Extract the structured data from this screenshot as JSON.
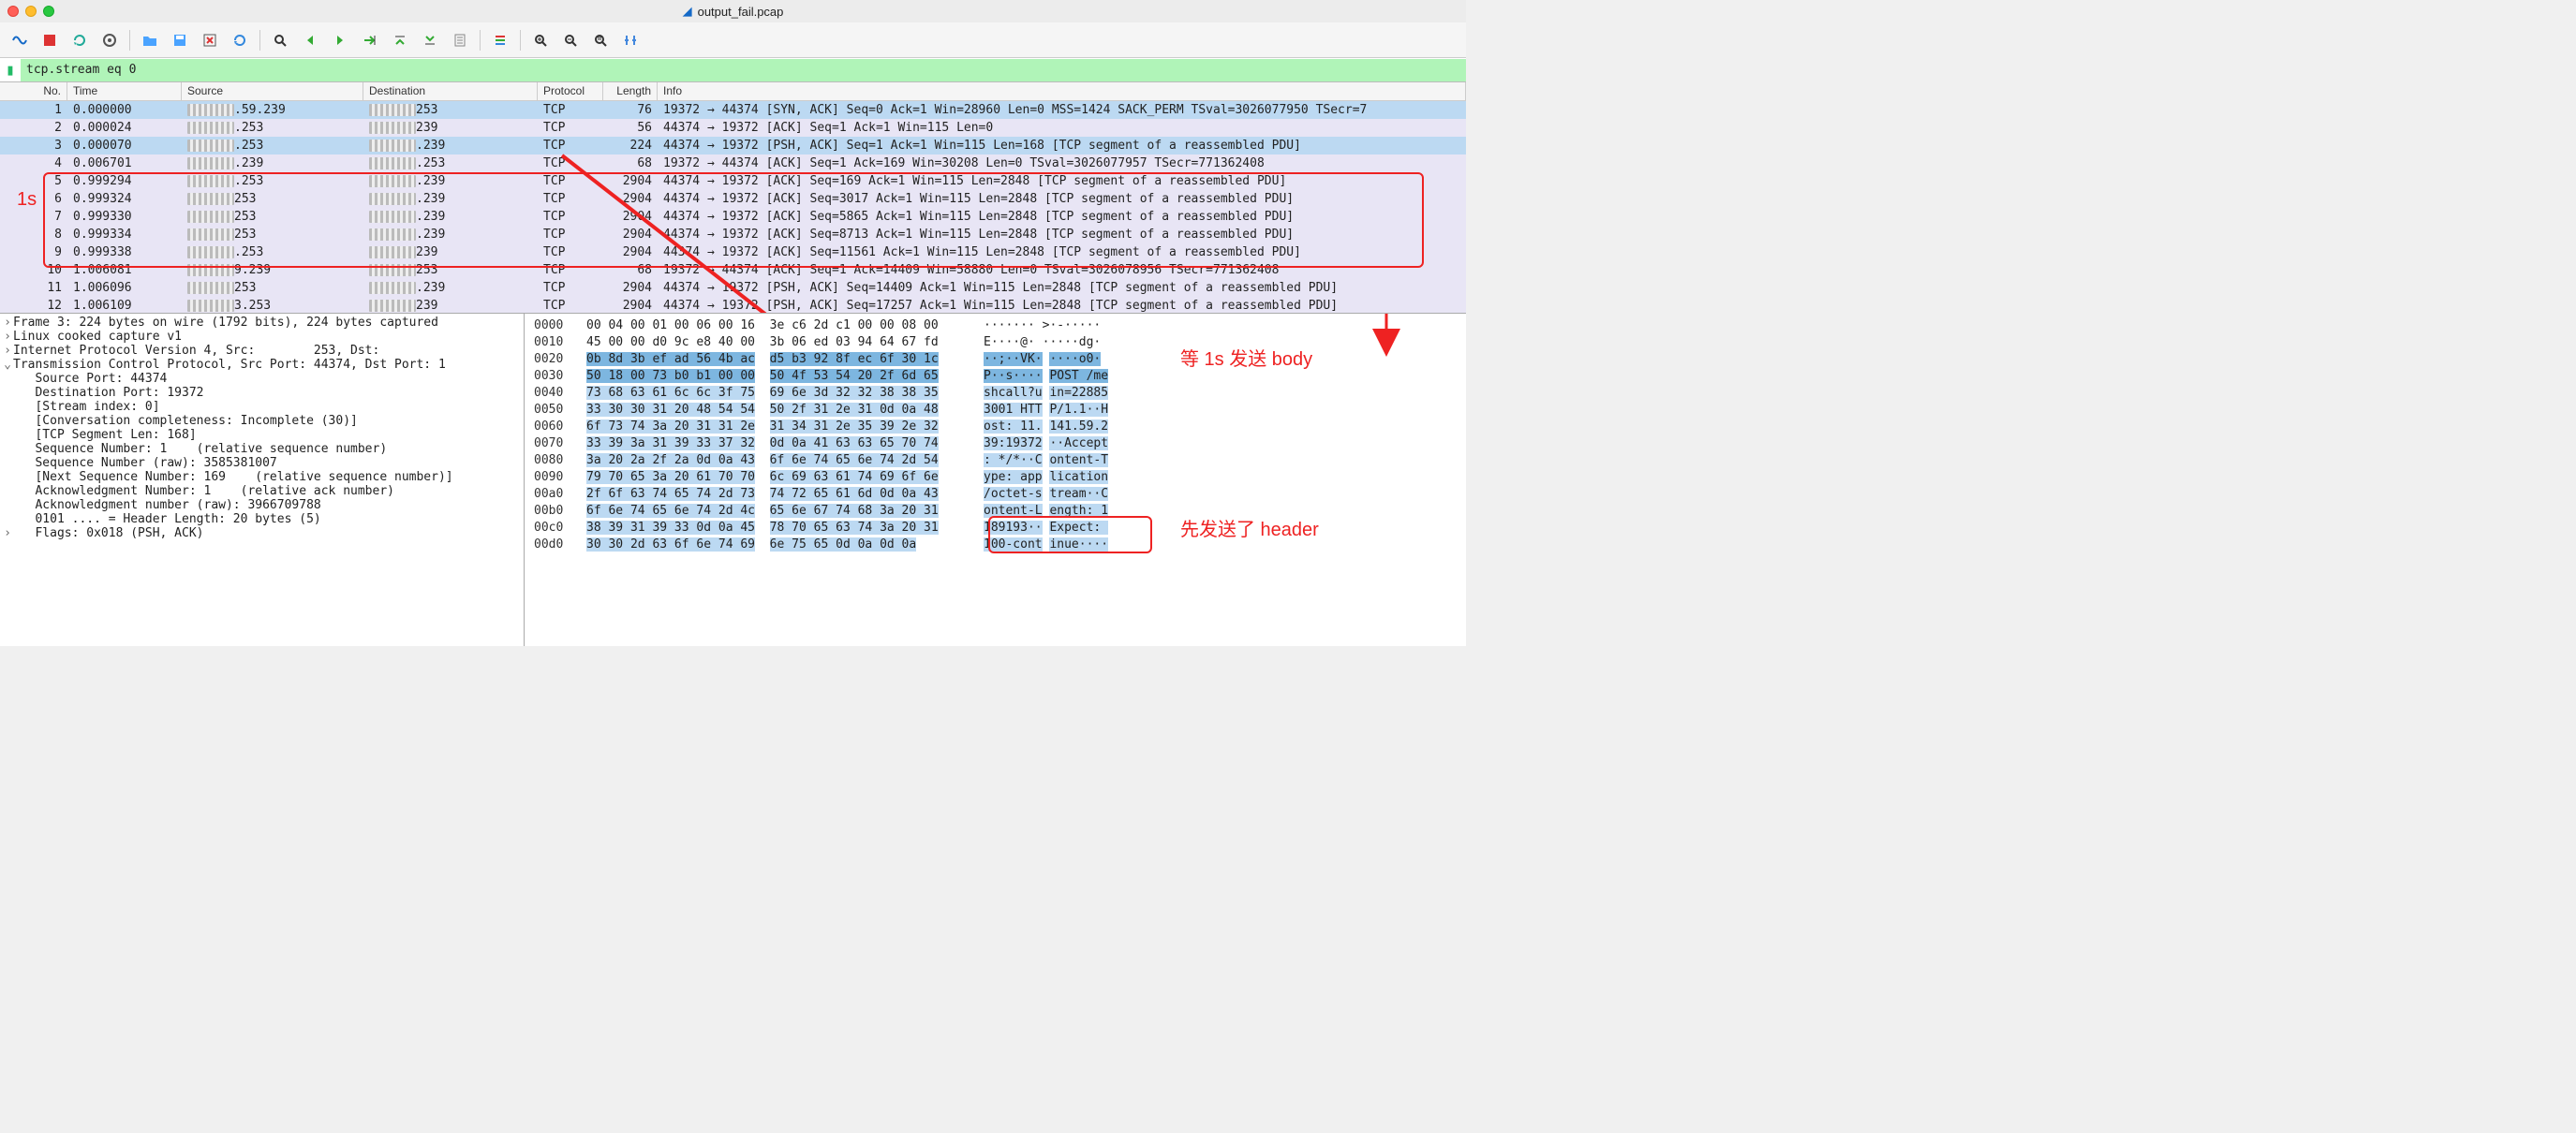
{
  "window": {
    "title": "output_fail.pcap"
  },
  "filter": {
    "value": "tcp.stream eq 0"
  },
  "columns": [
    "No.",
    "Time",
    "Source",
    "Destination",
    "Protocol",
    "Length",
    "Info"
  ],
  "packets": [
    {
      "no": "1",
      "time": "0.000000",
      "src_suffix": ".59.239",
      "dst_suffix": "253",
      "proto": "TCP",
      "len": "76",
      "info": "19372 → 44374 [SYN, ACK] Seq=0 Ack=1 Win=28960 Len=0 MSS=1424 SACK_PERM TSval=3026077950 TSecr=7",
      "row": "sel"
    },
    {
      "no": "2",
      "time": "0.000024",
      "src_suffix": ".253",
      "dst_suffix": "239",
      "proto": "TCP",
      "len": "56",
      "info": "44374 → 19372 [ACK] Seq=1 Ack=1 Win=115 Len=0",
      "row": "light"
    },
    {
      "no": "3",
      "time": "0.000070",
      "src_suffix": ".253",
      "dst_suffix": ".239",
      "proto": "TCP",
      "len": "224",
      "info": "44374 → 19372 [PSH, ACK] Seq=1 Ack=1 Win=115 Len=168 [TCP segment of a reassembled PDU]",
      "row": "sel"
    },
    {
      "no": "4",
      "time": "0.006701",
      "src_suffix": ".239",
      "dst_suffix": ".253",
      "proto": "TCP",
      "len": "68",
      "info": "19372 → 44374 [ACK] Seq=1 Ack=169 Win=30208 Len=0 TSval=3026077957 TSecr=771362408",
      "row": "light"
    },
    {
      "no": "5",
      "time": "0.999294",
      "src_suffix": ".253",
      "dst_suffix": ".239",
      "proto": "TCP",
      "len": "2904",
      "info": "44374 → 19372 [ACK] Seq=169 Ack=1 Win=115 Len=2848 [TCP segment of a reassembled PDU]",
      "row": "light"
    },
    {
      "no": "6",
      "time": "0.999324",
      "src_suffix": "253",
      "dst_suffix": ".239",
      "proto": "TCP",
      "len": "2904",
      "info": "44374 → 19372 [ACK] Seq=3017 Ack=1 Win=115 Len=2848 [TCP segment of a reassembled PDU]",
      "row": "light"
    },
    {
      "no": "7",
      "time": "0.999330",
      "src_suffix": "253",
      "dst_suffix": ".239",
      "proto": "TCP",
      "len": "2904",
      "info": "44374 → 19372 [ACK] Seq=5865 Ack=1 Win=115 Len=2848 [TCP segment of a reassembled PDU]",
      "row": "light"
    },
    {
      "no": "8",
      "time": "0.999334",
      "src_suffix": "253",
      "dst_suffix": ".239",
      "proto": "TCP",
      "len": "2904",
      "info": "44374 → 19372 [ACK] Seq=8713 Ack=1 Win=115 Len=2848 [TCP segment of a reassembled PDU]",
      "row": "light"
    },
    {
      "no": "9",
      "time": "0.999338",
      "src_suffix": ".253",
      "dst_suffix": "239",
      "proto": "TCP",
      "len": "2904",
      "info": "44374 → 19372 [ACK] Seq=11561 Ack=1 Win=115 Len=2848 [TCP segment of a reassembled PDU]",
      "row": "light"
    },
    {
      "no": "10",
      "time": "1.006081",
      "src_suffix": "9.239",
      "dst_suffix": "253",
      "proto": "TCP",
      "len": "68",
      "info": "19372 → 44374 [ACK] Seq=1 Ack=14409 Win=58880 Len=0 TSval=3026078956 TSecr=771362408",
      "row": "light"
    },
    {
      "no": "11",
      "time": "1.006096",
      "src_suffix": "253",
      "dst_suffix": ".239",
      "proto": "TCP",
      "len": "2904",
      "info": "44374 → 19372 [PSH, ACK] Seq=14409 Ack=1 Win=115 Len=2848 [TCP segment of a reassembled PDU]",
      "row": "light"
    },
    {
      "no": "12",
      "time": "1.006109",
      "src_suffix": "3.253",
      "dst_suffix": "239",
      "proto": "TCP",
      "len": "2904",
      "info": "44374 → 19372 [PSH, ACK] Seq=17257 Ack=1 Win=115 Len=2848 [TCP segment of a reassembled PDU]",
      "row": "light"
    }
  ],
  "details": [
    {
      "exp": ">",
      "indent": 0,
      "text": "Frame 3: 224 bytes on wire (1792 bits), 224 bytes captured"
    },
    {
      "exp": ">",
      "indent": 0,
      "text": "Linux cooked capture v1"
    },
    {
      "exp": ">",
      "indent": 0,
      "text": "Internet Protocol Version 4, Src:        253, Dst:"
    },
    {
      "exp": "v",
      "indent": 0,
      "text": "Transmission Control Protocol, Src Port: 44374, Dst Port: 1"
    },
    {
      "exp": "",
      "indent": 1,
      "text": "Source Port: 44374"
    },
    {
      "exp": "",
      "indent": 1,
      "text": "Destination Port: 19372"
    },
    {
      "exp": "",
      "indent": 1,
      "text": "[Stream index: 0]"
    },
    {
      "exp": "",
      "indent": 1,
      "text": "[Conversation completeness: Incomplete (30)]"
    },
    {
      "exp": "",
      "indent": 1,
      "text": "[TCP Segment Len: 168]"
    },
    {
      "exp": "",
      "indent": 1,
      "text": "Sequence Number: 1    (relative sequence number)"
    },
    {
      "exp": "",
      "indent": 1,
      "text": "Sequence Number (raw): 3585381007"
    },
    {
      "exp": "",
      "indent": 1,
      "text": "[Next Sequence Number: 169    (relative sequence number)]"
    },
    {
      "exp": "",
      "indent": 1,
      "text": "Acknowledgment Number: 1    (relative ack number)"
    },
    {
      "exp": "",
      "indent": 1,
      "text": "Acknowledgment number (raw): 3966709788"
    },
    {
      "exp": "",
      "indent": 1,
      "text": "0101 .... = Header Length: 20 bytes (5)"
    },
    {
      "exp": ">",
      "indent": 1,
      "text": "Flags: 0x018 (PSH, ACK)"
    }
  ],
  "hex": [
    {
      "off": "0000",
      "b1": "00 04 00 01 00 06 00 16",
      "b2": "3e c6 2d c1 00 00 08 00",
      "a1": "·······",
      "a2": ">·-·····"
    },
    {
      "off": "0010",
      "b1": "45 00 00 d0 9c e8 40 00",
      "b2": "3b 06 ed 03 94 64 67 fd",
      "a1": "E····@·",
      "a2": "·····dg·"
    },
    {
      "off": "0020",
      "b1": "0b 8d 3b ef ad 56 4b ac",
      "b2": "d5 b3 92 8f ec 6f 30 1c",
      "a1": "··;··VK·",
      "a2": "····o0·",
      "hl": 2
    },
    {
      "off": "0030",
      "b1": "50 18 00 73 b0 b1 00 00",
      "b2": "50 4f 53 54 20 2f 6d 65",
      "a1": "P··s····",
      "a2": "POST /me",
      "hl": 2
    },
    {
      "off": "0040",
      "b1": "73 68 63 61 6c 6c 3f 75",
      "b2": "69 6e 3d 32 32 38 38 35",
      "a1": "shcall?u",
      "a2": "in=22885",
      "hl": 1
    },
    {
      "off": "0050",
      "b1": "33 30 30 31 20 48 54 54",
      "b2": "50 2f 31 2e 31 0d 0a 48",
      "a1": "3001 HTT",
      "a2": "P/1.1··H",
      "hl": 1
    },
    {
      "off": "0060",
      "b1": "6f 73 74 3a 20 31 31 2e",
      "b2": "31 34 31 2e 35 39 2e 32",
      "a1": "ost: 11.",
      "a2": "141.59.2",
      "hl": 1
    },
    {
      "off": "0070",
      "b1": "33 39 3a 31 39 33 37 32",
      "b2": "0d 0a 41 63 63 65 70 74",
      "a1": "39:19372",
      "a2": "··Accept",
      "hl": 1
    },
    {
      "off": "0080",
      "b1": "3a 20 2a 2f 2a 0d 0a 43",
      "b2": "6f 6e 74 65 6e 74 2d 54",
      "a1": ": */*··C",
      "a2": "ontent-T",
      "hl": 1
    },
    {
      "off": "0090",
      "b1": "79 70 65 3a 20 61 70 70",
      "b2": "6c 69 63 61 74 69 6f 6e",
      "a1": "ype: app",
      "a2": "lication",
      "hl": 1
    },
    {
      "off": "00a0",
      "b1": "2f 6f 63 74 65 74 2d 73",
      "b2": "74 72 65 61 6d 0d 0a 43",
      "a1": "/octet-s",
      "a2": "tream··C",
      "hl": 1
    },
    {
      "off": "00b0",
      "b1": "6f 6e 74 65 6e 74 2d 4c",
      "b2": "65 6e 67 74 68 3a 20 31",
      "a1": "ontent-L",
      "a2": "ength: 1",
      "hl": 1
    },
    {
      "off": "00c0",
      "b1": "38 39 31 39 33 0d 0a 45",
      "b2": "78 70 65 63 74 3a 20 31",
      "a1": "189193··",
      "a2": "Expect: ",
      "hl": 1
    },
    {
      "off": "00d0",
      "b1": "30 30 2d 63 6f 6e 74 69",
      "b2": "6e 75 65 0d 0a 0d 0a",
      "a1": "100-cont",
      "a2": "inue····",
      "hl": 1
    }
  ],
  "annotations": {
    "one_s": "1s",
    "body_label": "等 1s 发送 body",
    "header_label": "先发送了 header"
  }
}
